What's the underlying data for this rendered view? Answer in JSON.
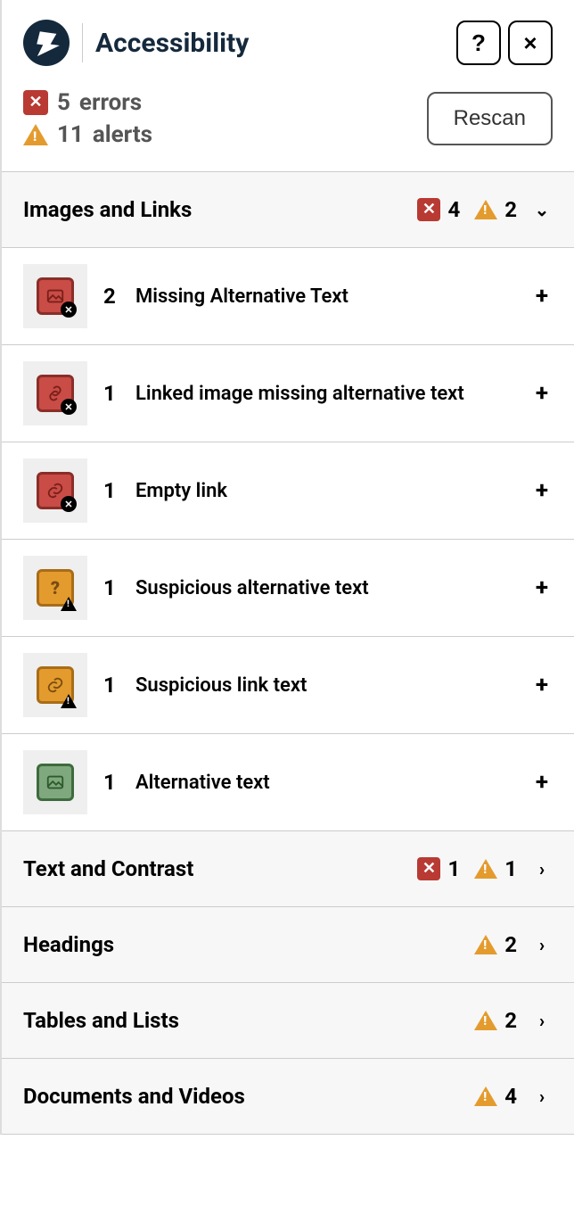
{
  "header": {
    "title": "Accessibility",
    "help_label": "?",
    "close_label": "×"
  },
  "summary": {
    "errors_count": "5",
    "errors_label": "errors",
    "alerts_count": "11",
    "alerts_label": "alerts",
    "rescan_label": "Rescan"
  },
  "categories": [
    {
      "title": "Images and Links",
      "errors": "4",
      "alerts": "2",
      "expanded": true,
      "issues": [
        {
          "count": "2",
          "label": "Missing Alternative Text",
          "tile": "red",
          "glyph": "image",
          "corner": "x"
        },
        {
          "count": "1",
          "label": "Linked image missing alternative text",
          "tile": "red",
          "glyph": "link-image",
          "corner": "x"
        },
        {
          "count": "1",
          "label": "Empty link",
          "tile": "red",
          "glyph": "link",
          "corner": "x"
        },
        {
          "count": "1",
          "label": "Suspicious alternative text",
          "tile": "amber",
          "glyph": "question",
          "corner": "tri"
        },
        {
          "count": "1",
          "label": "Suspicious link text",
          "tile": "amber",
          "glyph": "link",
          "corner": "tri"
        },
        {
          "count": "1",
          "label": "Alternative text",
          "tile": "green",
          "glyph": "image",
          "corner": ""
        }
      ]
    },
    {
      "title": "Text and Contrast",
      "errors": "1",
      "alerts": "1",
      "expanded": false
    },
    {
      "title": "Headings",
      "errors": "",
      "alerts": "2",
      "expanded": false
    },
    {
      "title": "Tables and Lists",
      "errors": "",
      "alerts": "2",
      "expanded": false
    },
    {
      "title": "Documents and Videos",
      "errors": "",
      "alerts": "4",
      "expanded": false
    }
  ],
  "glyphs": {
    "plus": "+",
    "chevron_down": "⌄",
    "chevron_right": "›"
  }
}
